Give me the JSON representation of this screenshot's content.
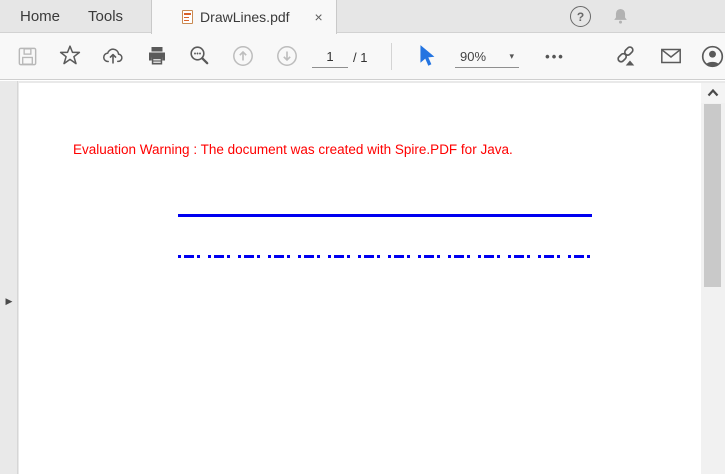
{
  "tabbar": {
    "home_label": "Home",
    "tools_label": "Tools",
    "active_tab": {
      "title": "DrawLines.pdf",
      "close_glyph": "×"
    },
    "help_glyph": "?"
  },
  "toolbar": {
    "page_current": "1",
    "page_separator": "/ 1",
    "zoom_level": "90%",
    "zoom_caret_glyph": "▾",
    "more_glyph": "•••"
  },
  "sidebar": {
    "expand_glyph": "▶"
  },
  "document": {
    "warning_text": "Evaluation Warning : The document was created with Spire.PDF for Java.",
    "warning_color": "#FF0000",
    "page_display": "1 / 1",
    "lines": [
      {
        "style": "solid",
        "color": "#0000F0"
      },
      {
        "style": "dash-dot",
        "color": "#0000F0"
      }
    ]
  },
  "icon_names": [
    "save-icon",
    "star-icon",
    "share-cloud-icon",
    "print-icon",
    "marquee-zoom-icon",
    "previous-page-icon",
    "next-page-icon",
    "select-tool-icon",
    "more-tools-icon",
    "share-link-icon",
    "email-icon",
    "account-icon",
    "help-icon",
    "notifications-icon",
    "pdf-file-icon",
    "close-icon",
    "panel-expand-icon",
    "scroll-up-icon"
  ],
  "colors": {
    "accent_blue": "#2374E1",
    "line_blue": "#0000F0",
    "warning_red": "#FF0000",
    "tabbar_bg": "#E6E6E6",
    "toolbar_bg": "#F8F8F8"
  }
}
